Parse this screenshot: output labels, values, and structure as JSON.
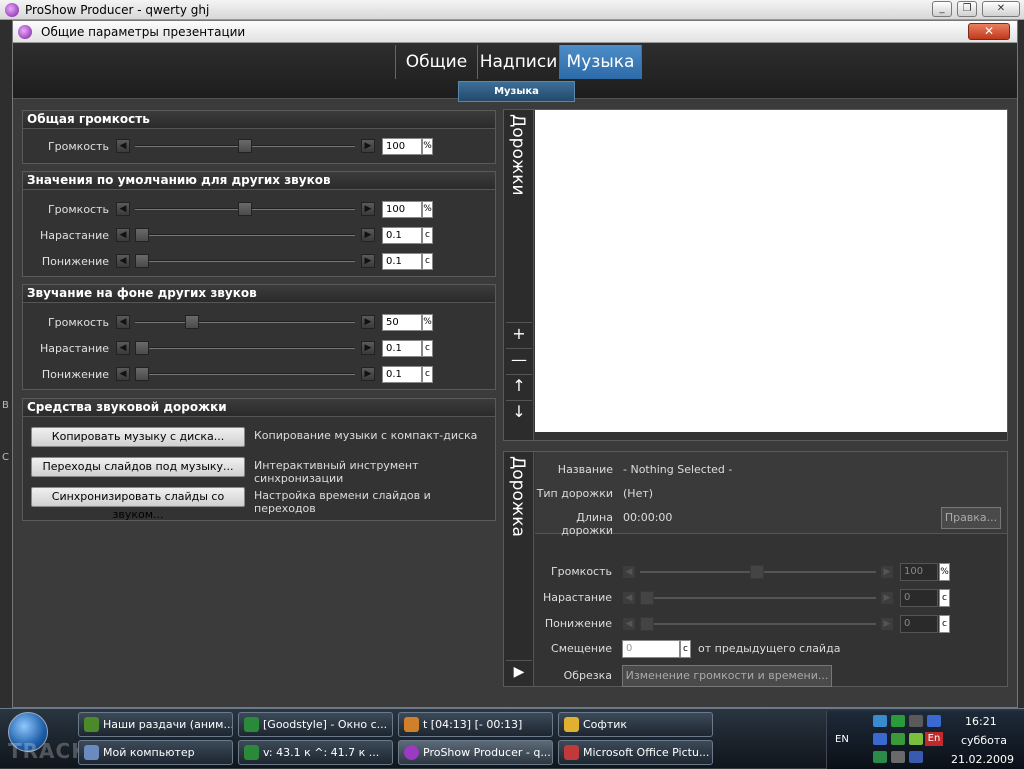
{
  "app": {
    "title": "ProShow Producer - qwerty ghj"
  },
  "dialog": {
    "title": "Общие параметры презентации",
    "close_glyph": "✕"
  },
  "tabs": [
    {
      "label": "Общие"
    },
    {
      "label": "Надписи"
    },
    {
      "label": "Музыка"
    }
  ],
  "subtab": "Музыка",
  "overall_volume": {
    "header": "Общая громкость",
    "volume_label": "Громкость",
    "volume_value": "100",
    "volume_unit": "%",
    "volume_level": 0.5
  },
  "defaults": {
    "header": "Значения по умолчанию для других звуков",
    "rows": [
      {
        "label": "Громкость",
        "value": "100",
        "unit": "%",
        "level": 0.5
      },
      {
        "label": "Нарастание",
        "value": "0.1",
        "unit": "c",
        "level": 0.0
      },
      {
        "label": "Понижение",
        "value": "0.1",
        "unit": "c",
        "level": 0.0
      }
    ]
  },
  "background": {
    "header": "Звучание на фоне других звуков",
    "rows": [
      {
        "label": "Громкость",
        "value": "50",
        "unit": "%",
        "level": 0.25
      },
      {
        "label": "Нарастание",
        "value": "0.1",
        "unit": "c",
        "level": 0.0
      },
      {
        "label": "Понижение",
        "value": "0.1",
        "unit": "c",
        "level": 0.0
      }
    ]
  },
  "tools": {
    "header": "Средства звуковой дорожки",
    "buttons": [
      {
        "label": "Копировать музыку с диска...",
        "desc": "Копирование музыки с компакт-диска"
      },
      {
        "label": "Переходы слайдов под музыку...",
        "desc": "Интерактивный инструмент синхронизации"
      },
      {
        "label": "Синхронизировать слайды со звуком...",
        "desc": "Настройка времени слайдов и переходов"
      }
    ]
  },
  "tracks": {
    "side_label": "Дорожки",
    "add_glyph": "+",
    "remove_glyph": "—",
    "up_glyph": "↑",
    "down_glyph": "↓"
  },
  "track": {
    "side_label": "Дорожка",
    "play_glyph": "▶",
    "name_label": "Название",
    "name_value": "- Nothing Selected -",
    "type_label": "Тип дорожки",
    "type_value": "(Нет)",
    "length_label": "Длина дорожки",
    "length_value": "00:00:00",
    "edit_button": "Правка...",
    "volume_label": "Громкость",
    "volume_value": "100",
    "volume_unit": "%",
    "fadein_label": "Нарастание",
    "fadein_value": "0",
    "fadein_unit": "c",
    "fadeout_label": "Понижение",
    "fadeout_value": "0",
    "fadeout_unit": "c",
    "offset_label": "Смещение",
    "offset_value": "0",
    "offset_unit": "c",
    "offset_suffix": "от предыдущего слайда",
    "trim_label": "Обрезка",
    "trim_button": "Изменение громкости и времени..."
  },
  "arrows": {
    "left": "◀",
    "right": "▶"
  },
  "taskbar": {
    "watermark": "TRACKER",
    "row1": [
      {
        "label": "Наши раздачи (аним...",
        "color": "#4a8a2a"
      },
      {
        "label": "[Goodstyle] - Окно с...",
        "color": "#2a8a3a"
      },
      {
        "label": "t [04:13] [- 00:13]",
        "color": "#d0802a"
      },
      {
        "label": "Софтик",
        "color": "#e0b030"
      }
    ],
    "row2": [
      {
        "label": "Мой компьютер",
        "color": "#6a8ac0"
      },
      {
        "label": "v: 43.1 к ^: 41.7 к ...",
        "color": "#2a8a3a"
      },
      {
        "label": "ProShow Producer - q...",
        "color": "#9a3ac0"
      },
      {
        "label": "Microsoft Office Pictu...",
        "color": "#c03a3a"
      }
    ],
    "lang": "EN",
    "lang2": "En",
    "time": "16:21",
    "day": "суббота",
    "date": "21.02.2009"
  }
}
